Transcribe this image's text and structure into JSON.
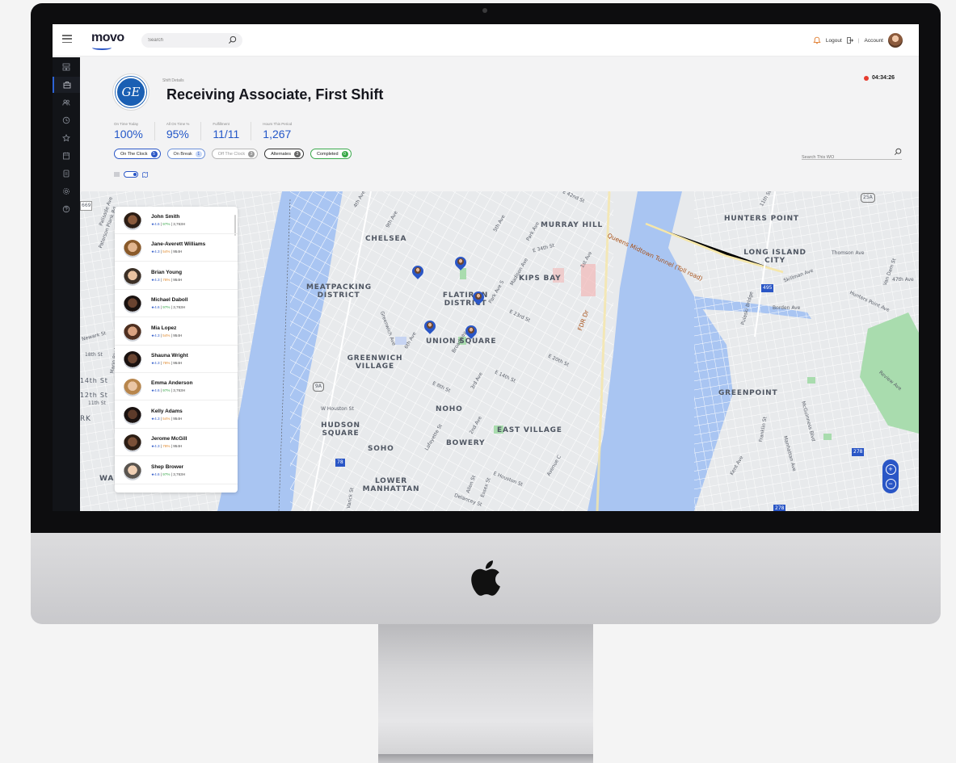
{
  "topbar": {
    "brand": "movo",
    "search_placeholder": "Search",
    "logout_label": "Logout",
    "account_label": "Account",
    "separator": "|"
  },
  "sidebar": {
    "items": [
      {
        "icon": "dashboard-icon"
      },
      {
        "icon": "briefcase-icon",
        "active": true
      },
      {
        "icon": "people-icon"
      },
      {
        "icon": "clock-icon"
      },
      {
        "icon": "star-icon"
      },
      {
        "icon": "calendar-icon"
      },
      {
        "icon": "document-icon"
      },
      {
        "icon": "settings-icon"
      },
      {
        "icon": "help-icon"
      }
    ]
  },
  "shift": {
    "caption": "Shift Details",
    "title": "Receiving Associate, First Shift",
    "timer": "04:34:26",
    "logo_text": "GE"
  },
  "stats": [
    {
      "label": "On Time Today",
      "value": "100%"
    },
    {
      "label": "All On Time %",
      "value": "95%"
    },
    {
      "label": "Fulfillment",
      "value": "11/11"
    },
    {
      "label": "Hours This Period",
      "value": "1,267"
    }
  ],
  "filters": [
    {
      "label": "On The Clock",
      "count": "5",
      "style": "clock"
    },
    {
      "label": "On Break",
      "count": "1",
      "style": "brk"
    },
    {
      "label": "Off The Clock",
      "count": "3",
      "style": "off"
    },
    {
      "label": "Alternates",
      "count": "3",
      "style": "alt"
    },
    {
      "label": "Completed",
      "count": "0",
      "style": "done"
    }
  ],
  "wo_search": {
    "placeholder": "Search This WO"
  },
  "workers": [
    {
      "name": "John Smith",
      "rating": "★4.6",
      "pct": "97%",
      "pct_color": "green",
      "hours": "3,763H",
      "skin": "#8a5a3c",
      "hair": "#2b1d14"
    },
    {
      "name": "Jane-Averett Williams",
      "rating": "★4.3",
      "pct": "54%",
      "pct_color": "orange",
      "hours": "954H",
      "skin": "#e2b58e",
      "hair": "#8a5a2a"
    },
    {
      "name": "Brian Young",
      "rating": "★4.3",
      "pct": "78%",
      "pct_color": "orange",
      "hours": "954H",
      "skin": "#e9c2a0",
      "hair": "#3c3026"
    },
    {
      "name": "Michael Daboll",
      "rating": "★4.6",
      "pct": "97%",
      "pct_color": "green",
      "hours": "3,763H",
      "skin": "#6a4330",
      "hair": "#1a1210"
    },
    {
      "name": "Mia Lopez",
      "rating": "★4.3",
      "pct": "54%",
      "pct_color": "orange",
      "hours": "954H",
      "skin": "#d9a382",
      "hair": "#4e2f20"
    },
    {
      "name": "Shauna Wright",
      "rating": "★4.3",
      "pct": "78%",
      "pct_color": "orange",
      "hours": "954H",
      "skin": "#6b4532",
      "hair": "#1a1210"
    },
    {
      "name": "Emma Anderson",
      "rating": "★4.6",
      "pct": "97%",
      "pct_color": "green",
      "hours": "3,763H",
      "skin": "#eac6a5",
      "hair": "#b8864c"
    },
    {
      "name": "Kelly Adams",
      "rating": "★4.3",
      "pct": "54%",
      "pct_color": "orange",
      "hours": "954H",
      "skin": "#5d3b2a",
      "hair": "#1a1210"
    },
    {
      "name": "Jerome McGill",
      "rating": "★4.3",
      "pct": "78%",
      "pct_color": "orange",
      "hours": "954H",
      "skin": "#7a5038",
      "hair": "#2b1d14"
    },
    {
      "name": "Shep Brower",
      "rating": "★4.6",
      "pct": "97%",
      "pct_color": "green",
      "hours": "3,763H",
      "skin": "#efcfb4",
      "hair": "#5a5550"
    }
  ],
  "map": {
    "neighborhoods": [
      "HUNTERS POINT",
      "CHELSEA",
      "MURRAY HILL",
      "LONG ISLAND CITY",
      "KIPS BAY",
      "MEATPACKING DISTRICT",
      "FLATIRON DISTRICT",
      "UNION SQUARE",
      "GREENWICH VILLAGE",
      "GREENPOINT",
      "NOHO",
      "HUDSON SQUARE",
      "EAST VILLAGE",
      "BOWERY",
      "SOHO",
      "LOWER MANHATTAN",
      "WA"
    ],
    "streets": [
      "Queens Midtown Tunnel (Toll road)",
      "Thomson Ave",
      "Skillman Ave",
      "Borden Ave",
      "Hunters Point Ave",
      "47th Ave",
      "Van Dam St",
      "Pulaski Bridge",
      "FDR Dr",
      "E 34th St",
      "Park Ave",
      "Madison Ave",
      "5th Ave",
      "9th Ave",
      "1st Ave",
      "Park Ave S",
      "E 23rd St",
      "E 20th St",
      "E 14th St",
      "E 8th St",
      "3rd Ave",
      "Broadway",
      "W Houston St",
      "E Houston St",
      "Lafayette St",
      "2nd Ave",
      "Avenue C",
      "Allen St",
      "Essex St",
      "Delancey St",
      "Varick St",
      "6th Ave",
      "Greenwich Ave",
      "Franklin St",
      "McGuinness Blvd",
      "Manhattan Ave",
      "Kent Ave",
      "Review Ave",
      "Newark St",
      "18th St",
      "14th St",
      "12th St",
      "11th St",
      "Marin Blvd",
      "Paterson Plank Rd",
      "Palisade Ave",
      "E 42nd St",
      "11th St",
      "4th Ave",
      "RK"
    ],
    "shields": [
      "669",
      "25A",
      "495",
      "9A",
      "278",
      "278",
      "78"
    ],
    "zoom_in": "+",
    "zoom_out": "−"
  }
}
